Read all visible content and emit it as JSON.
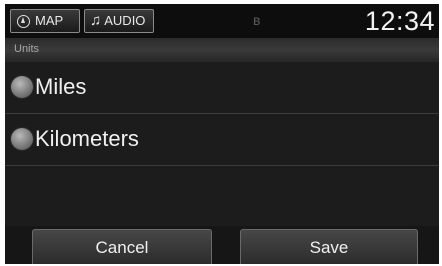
{
  "topbar": {
    "map_label": "MAP",
    "audio_label": "AUDIO",
    "bluetooth_glyph": "ʙ",
    "clock": "12:34"
  },
  "section": {
    "title": "Units"
  },
  "options": [
    {
      "label": "Miles",
      "icon": "radio-button-icon"
    },
    {
      "label": "Kilometers",
      "icon": "radio-button-icon"
    }
  ],
  "actions": {
    "cancel_label": "Cancel",
    "save_label": "Save"
  },
  "colors": {
    "background": "#1c1c1c",
    "text": "#f0f0f0",
    "header_text": "#a8a8a8"
  }
}
